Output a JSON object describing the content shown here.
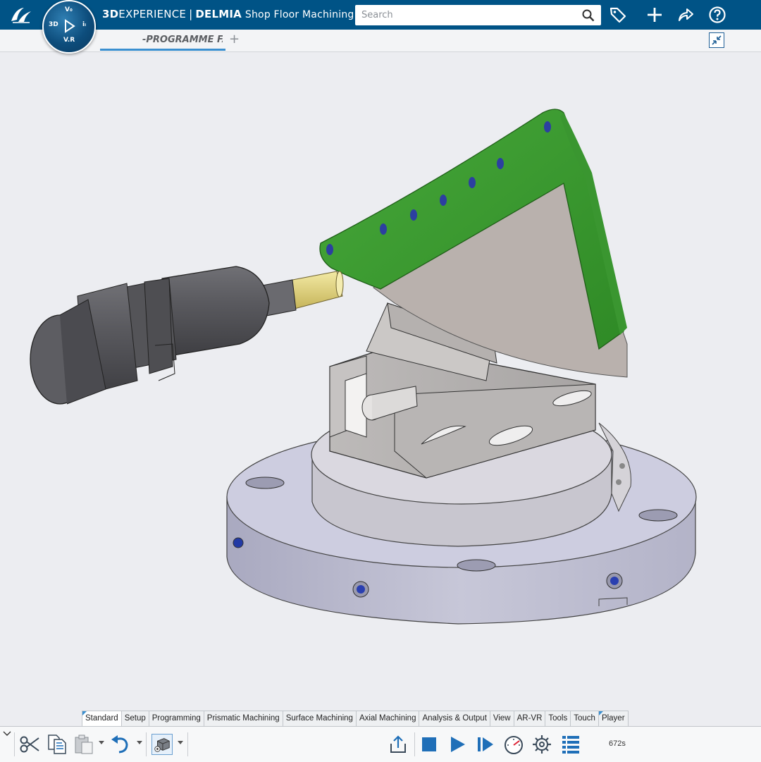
{
  "topbar": {
    "brand_bold": "3D",
    "brand_rest": "EXPERIENCE",
    "separator": "|",
    "product": "DELMIA",
    "module": "Shop Floor Machining",
    "compass": {
      "top": "V₀",
      "left": "3D",
      "right": "iᵢ",
      "bottom": "V.R"
    },
    "search": {
      "placeholder": "Search",
      "value": ""
    }
  },
  "tabstrip": {
    "active_tab": "-PROGRAMME FA",
    "add_tab": "+"
  },
  "section_tabs": [
    "Standard",
    "Setup",
    "Programming",
    "Prismatic Machining",
    "Surface Machining",
    "Axial Machining",
    "Analysis & Output",
    "View",
    "AR-VR",
    "Tools",
    "Touch",
    "Player"
  ],
  "action_bar": {
    "timer": "672s",
    "icons": [
      "scissors-icon",
      "copy-icon",
      "paste-icon",
      "undo-icon",
      "view-mode-icon",
      "export-icon",
      "stop-icon",
      "play-icon",
      "step-forward-icon",
      "speed-gauge-icon",
      "settings-icon",
      "list-icon"
    ]
  },
  "colors": {
    "topbar": "#005386",
    "part_green": "#3c9a2f",
    "accent_blue": "#3a8fd0"
  }
}
